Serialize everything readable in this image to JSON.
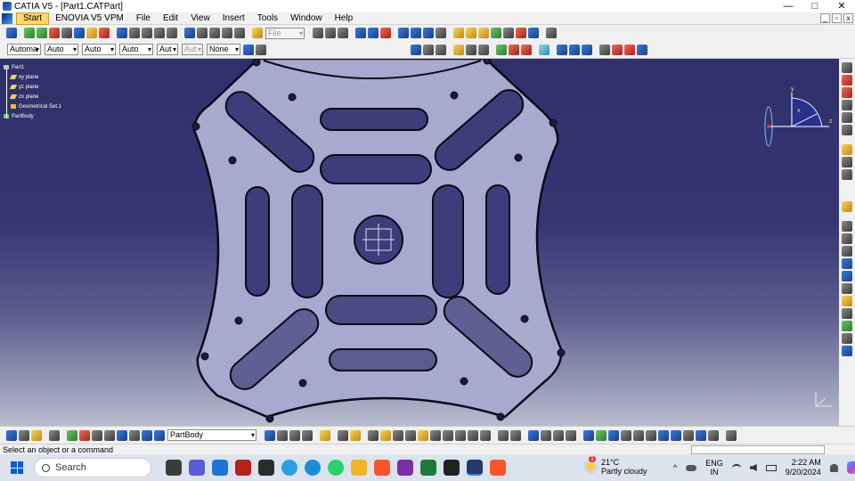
{
  "window": {
    "title": "CATIA V5 - [Part1.CATPart]",
    "controls": {
      "minimize": "—",
      "maximize": "□",
      "close": "✕"
    }
  },
  "menu": {
    "items": [
      "Start",
      "ENOVIA V5 VPM",
      "File",
      "Edit",
      "View",
      "Insert",
      "Tools",
      "Window",
      "Help"
    ],
    "mdi": {
      "minimize": "_",
      "restore": "▫",
      "close": "x"
    }
  },
  "toolbar2": {
    "combos": [
      "Automa",
      "Auto",
      "Auto",
      "Auto",
      "Aut",
      "Aut",
      "None"
    ],
    "file_combo": "File"
  },
  "tree": {
    "root": "Part1",
    "children": [
      "xy plane",
      "yz plane",
      "zx plane",
      "Geometrical Set.1",
      "PartBody"
    ]
  },
  "compass": {
    "x": "x",
    "y": "y",
    "z": "z"
  },
  "bottombar": {
    "body_combo": "PartBody"
  },
  "status": {
    "message": "Select an object or a command"
  },
  "taskbar": {
    "search": "Search",
    "weather_temp": "21°C",
    "weather_desc": "Partly cloudy",
    "weather_badge": "1",
    "lang_top": "ENG",
    "lang_bottom": "IN",
    "time": "2:22 AM",
    "date": "9/20/2024"
  },
  "icons": {
    "tree_root": "part-icon",
    "taskbar_search": "search-icon",
    "taskbar_start": "windows-start-icon"
  }
}
